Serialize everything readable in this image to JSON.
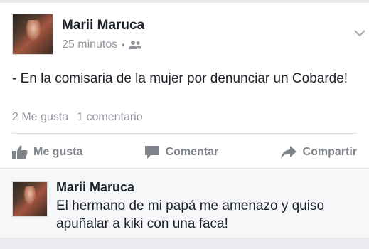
{
  "post": {
    "author": "Marii Maruca",
    "time": "25 minutos",
    "separator": "•",
    "privacy_icon": "friends-icon",
    "text": "- En la comisaria de la mujer por denunciar un Cobarde!",
    "likes": "2 Me gusta",
    "comments_count": "1 comentario"
  },
  "actions": {
    "like_label": "Me gusta",
    "comment_label": "Comentar",
    "share_label": "Compartir"
  },
  "comment": {
    "author": "Marii Maruca",
    "text": "El hermano de mi papá me amenazo y quiso apuñalar a kiki con una faca!"
  },
  "colors": {
    "text": "#1d2129",
    "muted": "#90949c",
    "action": "#7f838a",
    "comment_bg": "#f6f7f9"
  }
}
